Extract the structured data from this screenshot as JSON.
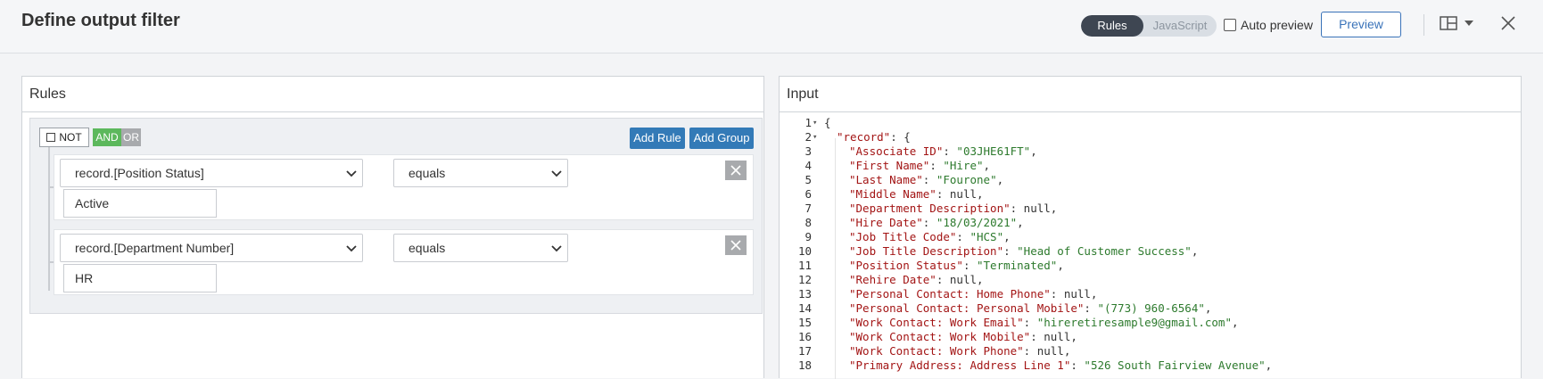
{
  "header": {
    "title": "Define output filter",
    "mode_rules": "Rules",
    "mode_javascript": "JavaScript",
    "auto_preview_label": "Auto preview",
    "preview_label": "Preview"
  },
  "rules_panel": {
    "title": "Rules",
    "not_label": "NOT",
    "and_label": "AND",
    "or_label": "OR",
    "add_rule_label": "Add Rule",
    "add_group_label": "Add Group",
    "rules": [
      {
        "field": "record.[Position Status]",
        "operator": "equals",
        "value": "Active"
      },
      {
        "field": "record.[Department Number]",
        "operator": "equals",
        "value": "HR"
      }
    ]
  },
  "input_panel": {
    "title": "Input",
    "lines": [
      {
        "n": "1",
        "fold": true,
        "indent": 0,
        "key": "",
        "sep": "{",
        "val": "",
        "tail": ""
      },
      {
        "n": "2",
        "fold": true,
        "indent": 1,
        "key": "\"record\"",
        "sep": ": {",
        "val": "",
        "tail": ""
      },
      {
        "n": "3",
        "indent": 2,
        "key": "\"Associate ID\"",
        "sep": ": ",
        "val": "\"03JHE61FT\"",
        "tail": ","
      },
      {
        "n": "4",
        "indent": 2,
        "key": "\"First Name\"",
        "sep": ": ",
        "val": "\"Hire\"",
        "tail": ","
      },
      {
        "n": "5",
        "indent": 2,
        "key": "\"Last Name\"",
        "sep": ": ",
        "val": "\"Fourone\"",
        "tail": ","
      },
      {
        "n": "6",
        "indent": 2,
        "key": "\"Middle Name\"",
        "sep": ": null,",
        "val": "",
        "tail": ""
      },
      {
        "n": "7",
        "indent": 2,
        "key": "\"Department Description\"",
        "sep": ": null,",
        "val": "",
        "tail": ""
      },
      {
        "n": "8",
        "indent": 2,
        "key": "\"Hire Date\"",
        "sep": ": ",
        "val": "\"18/03/2021\"",
        "tail": ","
      },
      {
        "n": "9",
        "indent": 2,
        "key": "\"Job Title Code\"",
        "sep": ": ",
        "val": "\"HCS\"",
        "tail": ","
      },
      {
        "n": "10",
        "indent": 2,
        "key": "\"Job Title Description\"",
        "sep": ": ",
        "val": "\"Head of Customer Success\"",
        "tail": ","
      },
      {
        "n": "11",
        "indent": 2,
        "key": "\"Position Status\"",
        "sep": ": ",
        "val": "\"Terminated\"",
        "tail": ","
      },
      {
        "n": "12",
        "indent": 2,
        "key": "\"Rehire Date\"",
        "sep": ": null,",
        "val": "",
        "tail": ""
      },
      {
        "n": "13",
        "indent": 2,
        "key": "\"Personal Contact: Home Phone\"",
        "sep": ": null,",
        "val": "",
        "tail": ""
      },
      {
        "n": "14",
        "indent": 2,
        "key": "\"Personal Contact: Personal Mobile\"",
        "sep": ": ",
        "val": "\"(773) 960-6564\"",
        "tail": ","
      },
      {
        "n": "15",
        "indent": 2,
        "key": "\"Work Contact: Work Email\"",
        "sep": ": ",
        "val": "\"hireretiresample9@gmail.com\"",
        "tail": ","
      },
      {
        "n": "16",
        "indent": 2,
        "key": "\"Work Contact: Work Mobile\"",
        "sep": ": null,",
        "val": "",
        "tail": ""
      },
      {
        "n": "17",
        "indent": 2,
        "key": "\"Work Contact: Work Phone\"",
        "sep": ": null,",
        "val": "",
        "tail": ""
      },
      {
        "n": "18",
        "indent": 2,
        "key": "\"Primary Address: Address Line 1\"",
        "sep": ": ",
        "val": "\"526 South Fairview Avenue\"",
        "tail": ","
      }
    ]
  },
  "icons": {
    "layout": "layout-icon",
    "close": "close-icon",
    "caret": "chevron-down-icon",
    "delete": "close-icon",
    "fold": "fold-arrow-icon"
  },
  "colors": {
    "accent": "#337ab7",
    "and_active": "#5cb85c",
    "json_key": "#a31515",
    "json_string": "#2d7a2d"
  }
}
